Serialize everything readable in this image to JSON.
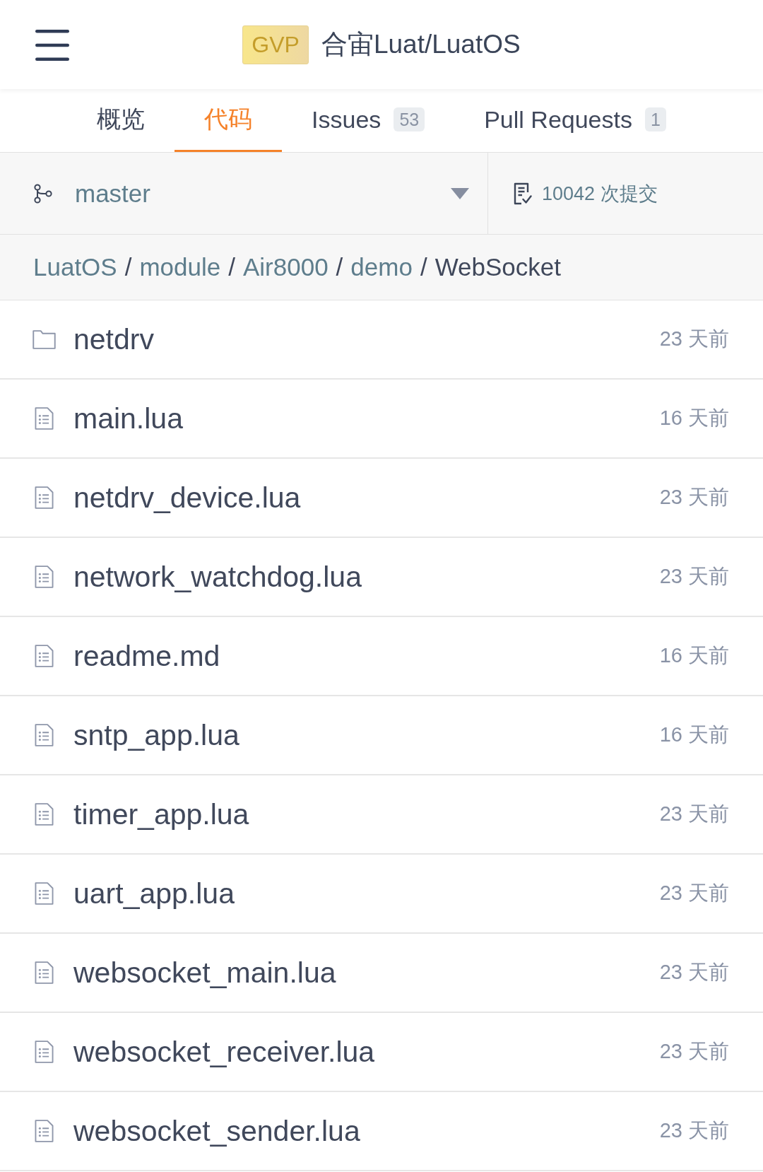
{
  "header": {
    "badge": "GVP",
    "title": "合宙Luat/LuatOS"
  },
  "tabs": [
    {
      "label": "概览",
      "selected": false
    },
    {
      "label": "代码",
      "selected": true
    },
    {
      "label": "Issues",
      "count": "53",
      "selected": false
    },
    {
      "label": "Pull Requests",
      "count": "1",
      "selected": false
    }
  ],
  "branch_bar": {
    "branch": "master",
    "commits": "10042 次提交"
  },
  "breadcrumb": {
    "separator": "/",
    "items": [
      {
        "label": "LuatOS",
        "kind": "link"
      },
      {
        "label": "module",
        "kind": "link"
      },
      {
        "label": "Air8000",
        "kind": "link"
      },
      {
        "label": "demo",
        "kind": "link"
      },
      {
        "label": "WebSocket",
        "kind": "current"
      }
    ]
  },
  "files": [
    {
      "name": "netdrv",
      "kind": "folder",
      "age": "23 天前"
    },
    {
      "name": "main.lua",
      "kind": "file",
      "age": "16 天前"
    },
    {
      "name": "netdrv_device.lua",
      "kind": "file",
      "age": "23 天前"
    },
    {
      "name": "network_watchdog.lua",
      "kind": "file",
      "age": "23 天前"
    },
    {
      "name": "readme.md",
      "kind": "file",
      "age": "16 天前"
    },
    {
      "name": "sntp_app.lua",
      "kind": "file",
      "age": "16 天前"
    },
    {
      "name": "timer_app.lua",
      "kind": "file",
      "age": "23 天前"
    },
    {
      "name": "uart_app.lua",
      "kind": "file",
      "age": "23 天前"
    },
    {
      "name": "websocket_main.lua",
      "kind": "file",
      "age": "23 天前"
    },
    {
      "name": "websocket_receiver.lua",
      "kind": "file",
      "age": "23 天前"
    },
    {
      "name": "websocket_sender.lua",
      "kind": "file",
      "age": "23 天前"
    }
  ]
}
